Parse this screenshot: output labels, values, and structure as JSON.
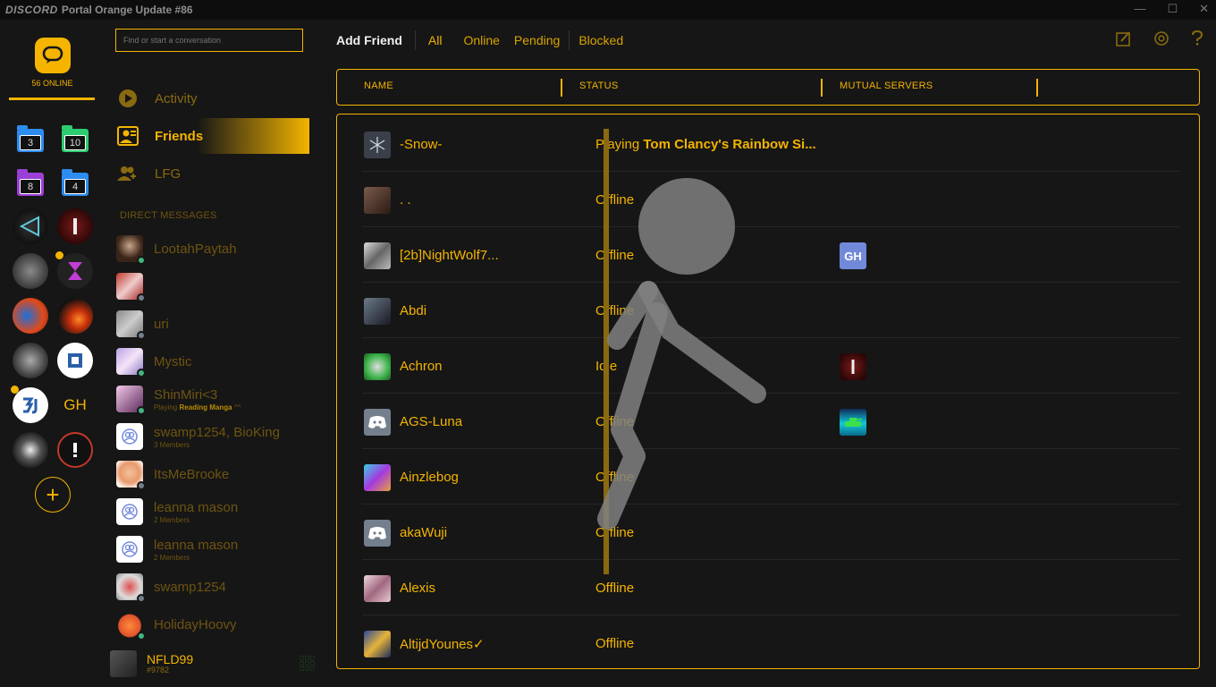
{
  "titlebar": {
    "logo": "DISCORD",
    "title": "Portal Orange Update #86",
    "minimize": "—",
    "maximize": "☐",
    "close": "✕"
  },
  "rail": {
    "online_count": "56 ONLINE",
    "folders": [
      "3",
      "10",
      "8",
      "4"
    ],
    "gh_label": "GH",
    "add_label": "+"
  },
  "search": {
    "placeholder": "Find or start a conversation"
  },
  "nav": {
    "activity": "Activity",
    "friends": "Friends",
    "lfg": "LFG"
  },
  "dm_header": "DIRECT MESSAGES",
  "dms": [
    {
      "name": "LootahPaytah",
      "sub": "",
      "status_color": "#43b581"
    },
    {
      "name": "",
      "sub": "",
      "status_color": "#747f8d"
    },
    {
      "name": "uri",
      "sub": "",
      "status_color": "#747f8d"
    },
    {
      "name": "Mystic",
      "sub": "",
      "status_color": "#43b581"
    },
    {
      "name": "ShinMiri<3",
      "sub_prefix": "Playing ",
      "sub_game": "Reading Manga",
      "sub_suffix": " ^^",
      "status_color": "#43b581"
    },
    {
      "name": "swamp1254, BioKing",
      "sub": "3 Members",
      "status_color": ""
    },
    {
      "name": "ItsMeBrooke",
      "sub": "",
      "status_color": "#747f8d"
    },
    {
      "name": "leanna mason",
      "sub": "2 Members",
      "status_color": ""
    },
    {
      "name": "leanna mason",
      "sub": "2 Members",
      "status_color": ""
    },
    {
      "name": "swamp1254",
      "sub": "",
      "status_color": "#747f8d"
    },
    {
      "name": "HolidayHoovy",
      "sub": "",
      "status_color": "#43b581"
    }
  ],
  "user": {
    "name": "NFLD99",
    "tag": "#9782"
  },
  "header": {
    "add_friend": "Add Friend",
    "tabs": [
      "All",
      "Online",
      "Pending",
      "Blocked"
    ]
  },
  "table": {
    "columns": [
      "NAME",
      "STATUS",
      "MUTUAL SERVERS"
    ],
    "rows": [
      {
        "name": "-Snow-",
        "status_prefix": "Playing ",
        "status_game": "Tom Clancy's Rainbow Si...",
        "mutual": ""
      },
      {
        "name": ". .",
        "status_prefix": "Offline",
        "status_game": "",
        "mutual": ""
      },
      {
        "name": "[2b]NightWolf7...",
        "status_prefix": "Offline",
        "status_game": "",
        "mutual": "GH"
      },
      {
        "name": "Abdi",
        "status_prefix": "Offline",
        "status_game": "",
        "mutual": ""
      },
      {
        "name": "Achron",
        "status_prefix": "Idle",
        "status_game": "",
        "mutual": ""
      },
      {
        "name": "AGS-Luna",
        "status_prefix": "Offline",
        "status_game": "",
        "mutual": ""
      },
      {
        "name": "Ainzlebog",
        "status_prefix": "Offline",
        "status_game": "",
        "mutual": ""
      },
      {
        "name": "akaWuji",
        "status_prefix": "Offline",
        "status_game": "",
        "mutual": ""
      },
      {
        "name": "Alexis",
        "status_prefix": "Offline",
        "status_game": "",
        "mutual": ""
      },
      {
        "name": "AltijdYounes✓",
        "status_prefix": "Offline",
        "status_game": "",
        "mutual": ""
      }
    ]
  },
  "colors": {
    "accent": "#f4b400",
    "background": "#161616",
    "online": "#43b581",
    "offline": "#747f8d",
    "discord_blurple": "#7289da"
  }
}
